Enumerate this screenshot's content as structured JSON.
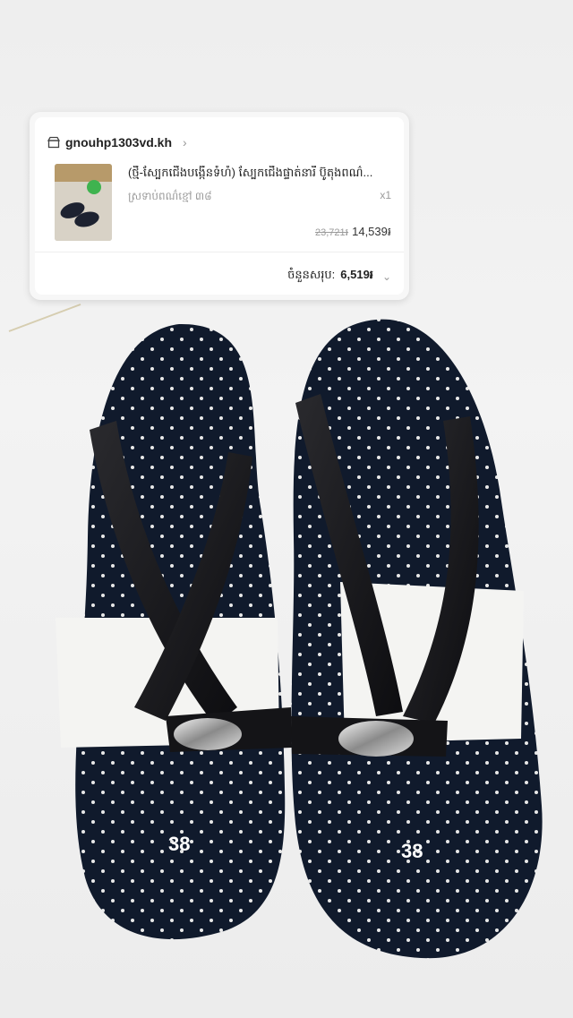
{
  "order_card": {
    "shop_icon": "store-icon",
    "shop_name": "gnouhp1303vd.kh",
    "chevron": "›",
    "product_title": "(ថ្មី-ស្បែកជើងបង្កើនទំហំ) ស្បែកជើងផ្ទាត់នារី ប៊ូតុងពណ៌...",
    "variant": "ស្រទាប់ពណ៌ខ្មៅ ៣៨",
    "quantity": "x1",
    "original_price": "23,721៛",
    "price": "14,539៛",
    "total_label": "ចំនួនសរុប:",
    "total_value": "6,519៛",
    "expand_icon": "chevron-down-icon"
  },
  "photo": {
    "left_size": "38",
    "right_size": "38"
  }
}
